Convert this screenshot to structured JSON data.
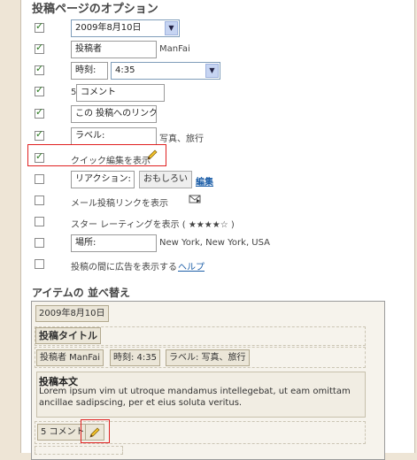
{
  "section_title": "投稿ページのオプション",
  "options": {
    "date_select": "2009年8月10日",
    "author_label": "投稿者",
    "author_name": "ManFai",
    "time_label": "時刻:",
    "time_value": "4:35",
    "comments_count": "5",
    "comments_label": "コメント",
    "permalink_label": "この 投稿へのリンク",
    "labels_label": "ラベル:",
    "labels_value": "写真、旅行",
    "quick_edit_label": "クイック編集を表示",
    "reactions_label": "リアクション:",
    "reactions_value": "おもしろい",
    "reactions_edit": "編集",
    "email_label": "メール投稿リンクを表示",
    "star_rating_label": "スター レーティングを表示 ( ★★★★☆ )",
    "location_label": "場所:",
    "location_value": "New York, New York, USA",
    "ads_label": "投稿の間に広告を表示する",
    "ads_help": "ヘルプ"
  },
  "reorder": {
    "title": "アイテムの 並べ替え",
    "date": "2009年8月10日",
    "post_title": "投稿タイトル",
    "author_chip": "投稿者 ManFai",
    "time_chip": "時刻: 4:35",
    "labels_chip": "ラベル: 写真、旅行",
    "body_title": "投稿本文",
    "body_text": "Lorem ipsum vim ut utroque mandamus intellegebat, ut eam omittam ancillae sadipscing, per et eius soluta veritus.",
    "comments_chip": "5 コメント"
  },
  "checkboxes": [
    true,
    true,
    true,
    true,
    true,
    true,
    true,
    false,
    false,
    false,
    false,
    false
  ]
}
